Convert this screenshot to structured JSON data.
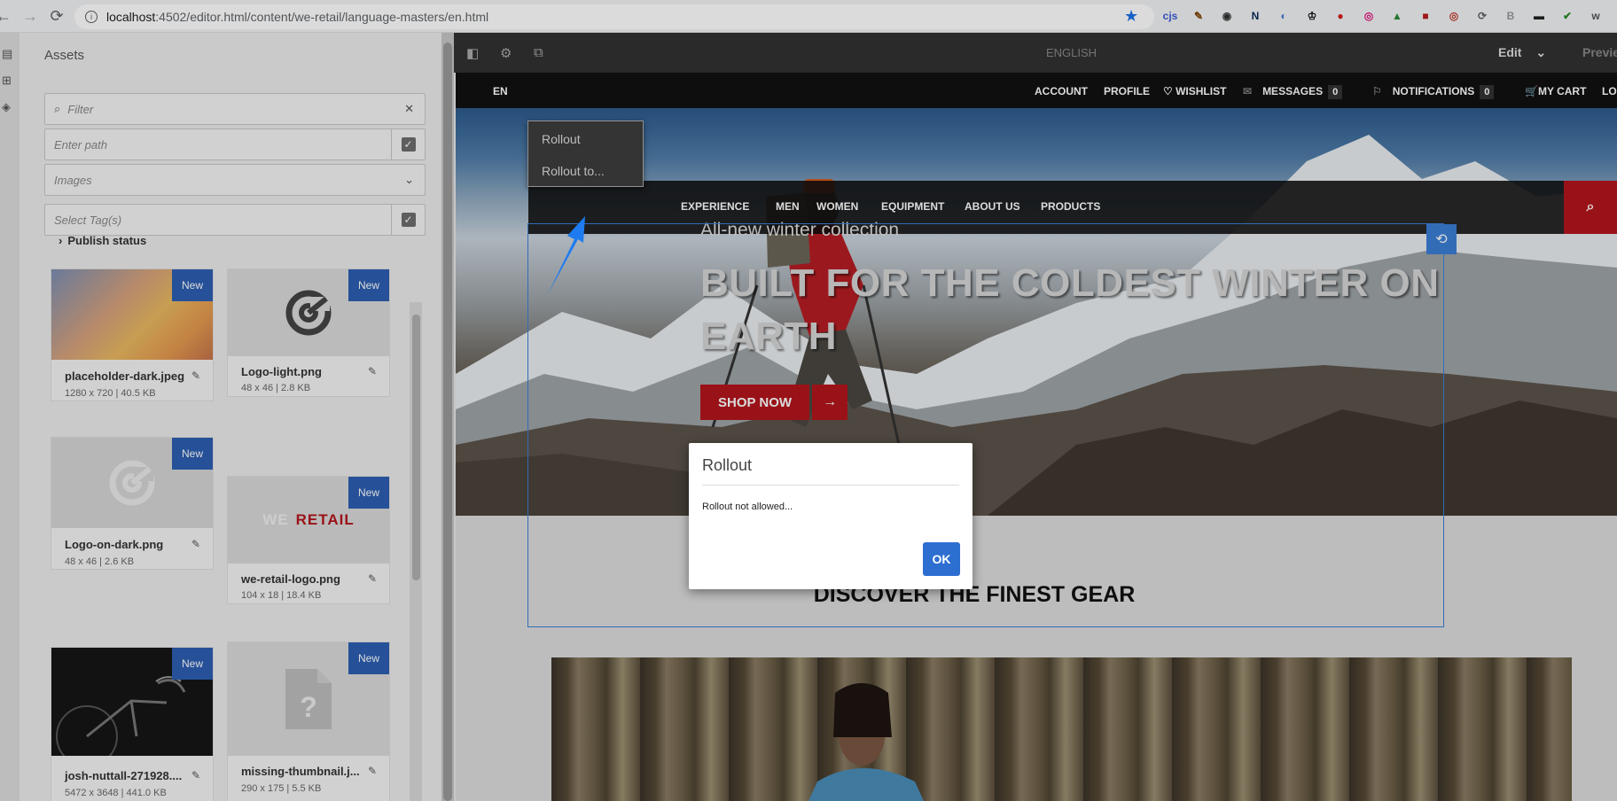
{
  "browser": {
    "url_host": "localhost",
    "url_path": ":4502/editor.html/content/we-retail/language-masters/en.html",
    "extensions": [
      "cjs",
      "✎",
      "◉",
      "N",
      "◐",
      "♔",
      "●",
      "◎",
      "▲",
      "■",
      "◎",
      "⟳",
      "B",
      "▬",
      "✔",
      "w"
    ]
  },
  "assets_panel": {
    "title": "Assets",
    "filter_placeholder": "Filter",
    "path_placeholder": "Enter path",
    "type_select": "Images",
    "tags_placeholder": "Select Tag(s)",
    "publish_status": "Publish status",
    "badge": "New",
    "cards": [
      {
        "name": "placeholder-dark.jpeg",
        "meta": "1280 x 720 | 40.5 KB"
      },
      {
        "name": "Logo-light.png",
        "meta": "48 x 46 | 2.8 KB"
      },
      {
        "name": "Logo-on-dark.png",
        "meta": "48 x 46 | 2.6 KB"
      },
      {
        "name": "we-retail-logo.png",
        "meta": "104 x 18 | 18.4 KB",
        "thumb_text_a": "WE",
        "thumb_text_b": "RETAIL"
      },
      {
        "name": "josh-nuttall-271928....",
        "meta": "5472 x 3648 | 441.0 KB"
      },
      {
        "name": "missing-thumbnail.j...",
        "meta": "290 x 175 | 5.5 KB"
      }
    ]
  },
  "editor_toolbar": {
    "title": "ENGLISH",
    "mode": "Edit",
    "preview": "Previe"
  },
  "top_nav": {
    "language": "EN",
    "account": "ACCOUNT",
    "profile": "PROFILE",
    "wishlist": "WISHLIST",
    "messages": "MESSAGES",
    "messages_count": "0",
    "notifications": "NOTIFICATIONS",
    "notifications_count": "0",
    "cart": "MY CART",
    "cut": "LO"
  },
  "main_nav": [
    "EXPERIENCE",
    "MEN",
    "WOMEN",
    "EQUIPMENT",
    "ABOUT US",
    "PRODUCTS"
  ],
  "hero": {
    "subtitle": "All-new winter collection",
    "title": "BUILT FOR THE COLDEST WINTER ON EARTH",
    "cta": "SHOP NOW"
  },
  "context_menu": {
    "item1": "Rollout",
    "item2": "Rollout to..."
  },
  "discover": "DISCOVER THE FINEST GEAR",
  "dialog": {
    "title": "Rollout",
    "message": "Rollout not allowed...",
    "ok": "OK"
  },
  "colors": {
    "accent_red": "#b3161c",
    "selection_blue": "#3c7ed4",
    "badge_blue": "#2d5fb2",
    "annotation_arrow": "#1e7bf0"
  }
}
